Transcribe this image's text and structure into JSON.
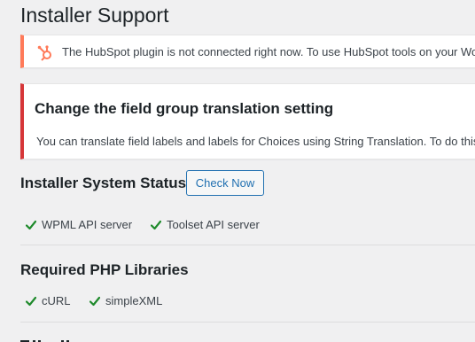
{
  "page": {
    "title": "Installer Support"
  },
  "notices": {
    "hubspot": {
      "icon": "hubspot-sprocket-icon",
      "accent": "#ff7a59",
      "text": "The HubSpot plugin is not connected right now. To use HubSpot tools on your Wo"
    },
    "wpml": {
      "accent": "#d63638",
      "title": "Change the field group translation setting",
      "text": "You can translate field labels and labels for Choices using String Translation. To do this,"
    }
  },
  "system_status": {
    "heading": "Installer System Status",
    "check_button_label": "Check Now",
    "items": [
      {
        "label": "WPML API server",
        "icon": "checkmark-icon"
      },
      {
        "label": "Toolset API server",
        "icon": "checkmark-icon"
      }
    ]
  },
  "php_libraries": {
    "heading": "Required PHP Libraries",
    "items": [
      {
        "label": "cURL",
        "icon": "checkmark-icon"
      },
      {
        "label": "simpleXML",
        "icon": "checkmark-icon"
      }
    ]
  },
  "colors": {
    "check_green": "#1e8a2b",
    "link_blue": "#2271b1"
  }
}
